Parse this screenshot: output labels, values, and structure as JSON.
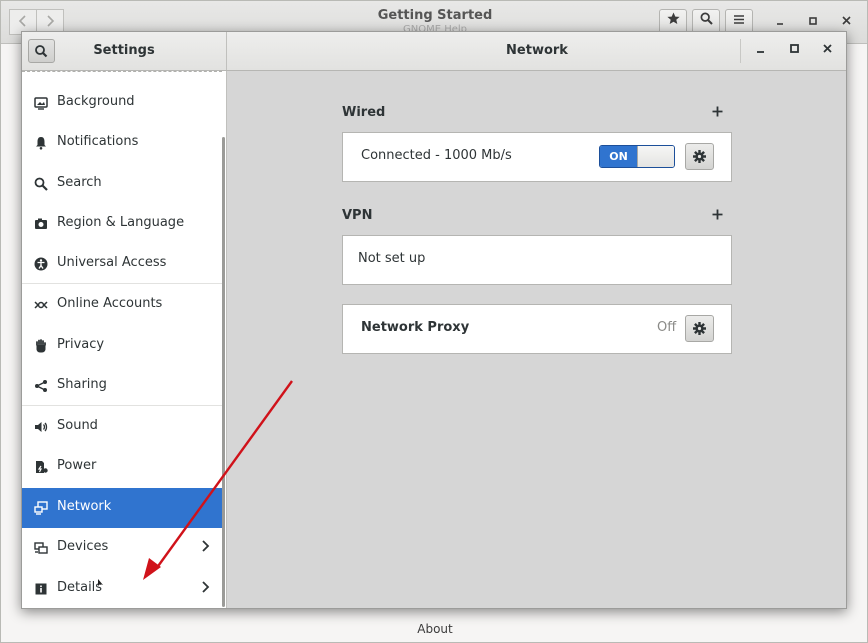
{
  "background_window": {
    "title": "Getting Started",
    "subtitle": "GNOME Help",
    "footer": "About"
  },
  "settings": {
    "sidebar_title": "Settings",
    "panel_title": "Network",
    "sidebar_items": [
      {
        "label": "Background",
        "icon": "background-icon"
      },
      {
        "label": "Notifications",
        "icon": "bell-icon"
      },
      {
        "label": "Search",
        "icon": "search-icon"
      },
      {
        "label": "Region & Language",
        "icon": "camera-icon"
      },
      {
        "label": "Universal Access",
        "icon": "accessibility-icon"
      },
      {
        "label": "Online Accounts",
        "icon": "online-accounts-icon"
      },
      {
        "label": "Privacy",
        "icon": "hand-icon"
      },
      {
        "label": "Sharing",
        "icon": "share-icon"
      },
      {
        "label": "Sound",
        "icon": "speaker-icon"
      },
      {
        "label": "Power",
        "icon": "power-icon"
      },
      {
        "label": "Network",
        "icon": "network-icon",
        "selected": true
      },
      {
        "label": "Devices",
        "icon": "devices-icon"
      },
      {
        "label": "Details",
        "icon": "info-icon"
      }
    ],
    "wired": {
      "title": "Wired",
      "status": "Connected - 1000 Mb/s",
      "toggle": "ON"
    },
    "vpn": {
      "title": "VPN",
      "status": "Not set up"
    },
    "proxy": {
      "label": "Network Proxy",
      "status": "Off"
    }
  },
  "colors": {
    "accent": "#3074cf",
    "arrow": "#d0121a"
  }
}
